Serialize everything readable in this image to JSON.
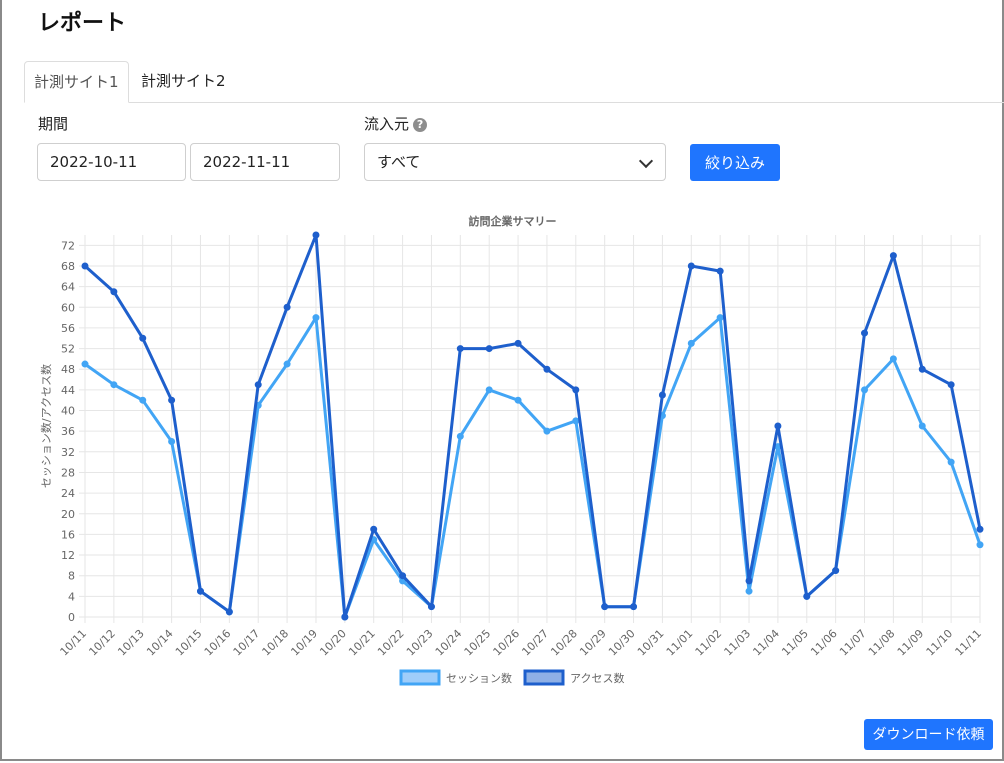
{
  "page": {
    "title": "レポート"
  },
  "tabs": [
    {
      "label": "計測サイト1",
      "active": true
    },
    {
      "label": "計測サイト2",
      "active": false
    }
  ],
  "filters": {
    "period_label": "期間",
    "start_date": "2022-10-11",
    "end_date": "2022-11-11",
    "source_label": "流入元",
    "source_help_icon": "question-circle-icon",
    "source_value": "すべて",
    "submit_label": "絞り込み"
  },
  "download_label": "ダウンロード依頼",
  "colors": {
    "accent": "#1f75fe",
    "session": "#42a5f5",
    "session_fill": "#9fcdfa",
    "access": "#1e5fcc",
    "access_fill": "#8fb0e6"
  },
  "chart_data": {
    "type": "line",
    "title": "訪問企業サマリー",
    "ylabel": "セッション数/アクセス数",
    "xlabel": "",
    "ylim": [
      0,
      74
    ],
    "ytick_step": 4,
    "grid": true,
    "legend_position": "bottom",
    "categories": [
      "10/11",
      "10/12",
      "10/13",
      "10/14",
      "10/15",
      "10/16",
      "10/17",
      "10/18",
      "10/19",
      "10/20",
      "10/21",
      "10/22",
      "10/23",
      "10/24",
      "10/25",
      "10/26",
      "10/27",
      "10/28",
      "10/29",
      "10/30",
      "10/31",
      "11/01",
      "11/02",
      "11/03",
      "11/04",
      "11/05",
      "11/06",
      "11/07",
      "11/08",
      "11/09",
      "11/10",
      "11/11"
    ],
    "series": [
      {
        "name": "セッション数",
        "values": [
          49,
          45,
          42,
          34,
          5,
          1,
          41,
          49,
          58,
          0,
          15,
          7,
          2,
          35,
          44,
          42,
          36,
          38,
          2,
          2,
          39,
          53,
          58,
          5,
          33,
          4,
          9,
          44,
          50,
          37,
          30,
          14
        ]
      },
      {
        "name": "アクセス数",
        "values": [
          68,
          63,
          54,
          42,
          5,
          1,
          45,
          60,
          74,
          0,
          17,
          8,
          2,
          52,
          52,
          53,
          48,
          44,
          2,
          2,
          43,
          68,
          67,
          7,
          37,
          4,
          9,
          55,
          70,
          48,
          45,
          17
        ]
      }
    ]
  }
}
